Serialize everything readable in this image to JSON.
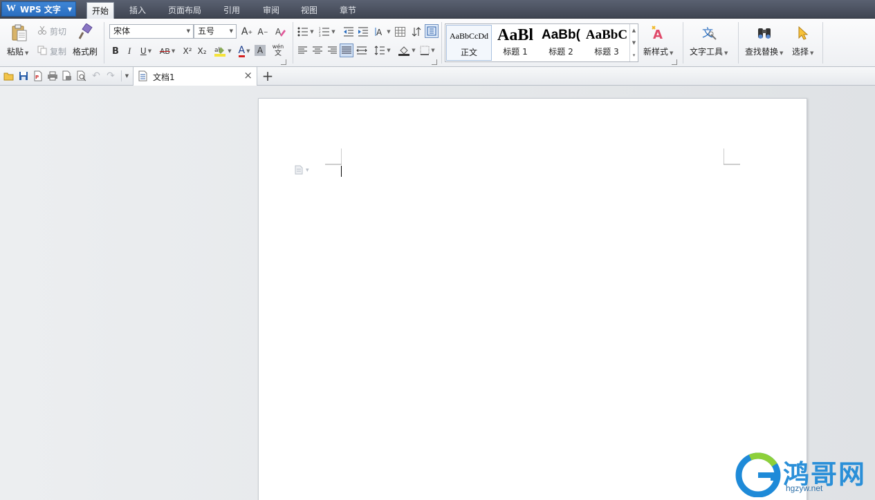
{
  "app": {
    "name": "WPS 文字"
  },
  "menu_tabs": [
    {
      "label": "开始",
      "active": true
    },
    {
      "label": "插入"
    },
    {
      "label": "页面布局"
    },
    {
      "label": "引用"
    },
    {
      "label": "审阅"
    },
    {
      "label": "视图"
    },
    {
      "label": "章节"
    }
  ],
  "clipboard": {
    "paste": "粘贴",
    "cut": "剪切",
    "copy": "复制",
    "format_painter": "格式刷"
  },
  "font": {
    "family": "宋体",
    "size": "五号"
  },
  "format_buttons": {
    "bold": "B",
    "italic": "I",
    "underline": "U",
    "strike": "AB",
    "superscript": "X²",
    "subscript": "X₂",
    "font_color": "A",
    "char_shade": "A",
    "phonetic": "wén",
    "phonetic_char": "文"
  },
  "styles": [
    {
      "sample": "AaBbCcDd",
      "name": "正文"
    },
    {
      "sample": "AaBl",
      "name": "标题 1"
    },
    {
      "sample": "AaBb(",
      "name": "标题 2"
    },
    {
      "sample": "AaBbC",
      "name": "标题 3"
    }
  ],
  "ribbon_right": {
    "new_style": "新样式",
    "text_tools": "文字工具",
    "find_replace": "查找替换",
    "select": "选择"
  },
  "document": {
    "tab_title": "文档1"
  },
  "watermark": {
    "text": "鸿哥网",
    "url": "hgzyw.net"
  },
  "colors": {
    "accent": "#2a6ec0",
    "topbar": "#4a505d",
    "highlight_yellow": "#f5e33a",
    "font_color_red": "#d42020",
    "watermark_blue": "#2a8fd8"
  }
}
